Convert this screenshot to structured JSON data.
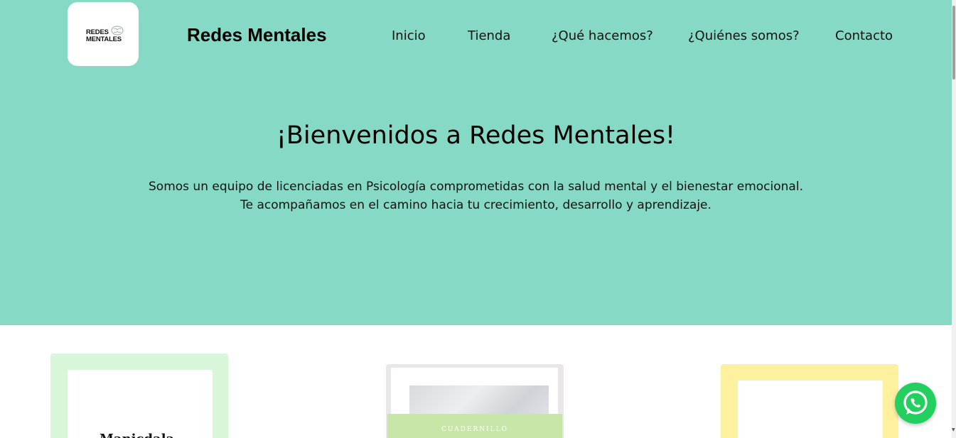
{
  "brand": {
    "logo_line1": "REDES",
    "logo_line2": "MENTALES",
    "site_title": "Redes Mentales"
  },
  "nav": {
    "items": [
      {
        "label": "Inicio"
      },
      {
        "label": "Tienda"
      },
      {
        "label": "¿Qué hacemos?"
      },
      {
        "label": "¿Quiénes somos?"
      },
      {
        "label": "Contacto"
      }
    ]
  },
  "hero": {
    "title": "¡Bienvenidos a Redes Mentales!",
    "line1": "Somos un equipo de licenciadas en Psicología comprometidas con la salud mental y el bienestar emocional.",
    "line2": "Te acompañamos en el camino hacia tu crecimiento, desarrollo y aprendizaje."
  },
  "cards": [
    {
      "visible_text": "Manicdala"
    },
    {
      "visible_text": "CUADERNILLO"
    },
    {
      "visible_text": ""
    }
  ],
  "floating": {
    "icon": "whatsapp-icon"
  },
  "colors": {
    "hero_bg": "#86d9c5",
    "card1_frame": "#d8f6da",
    "card2_band": "#c8e6a7",
    "card3_frame": "#fdf1a0",
    "whatsapp_green": "#23cf5f"
  }
}
